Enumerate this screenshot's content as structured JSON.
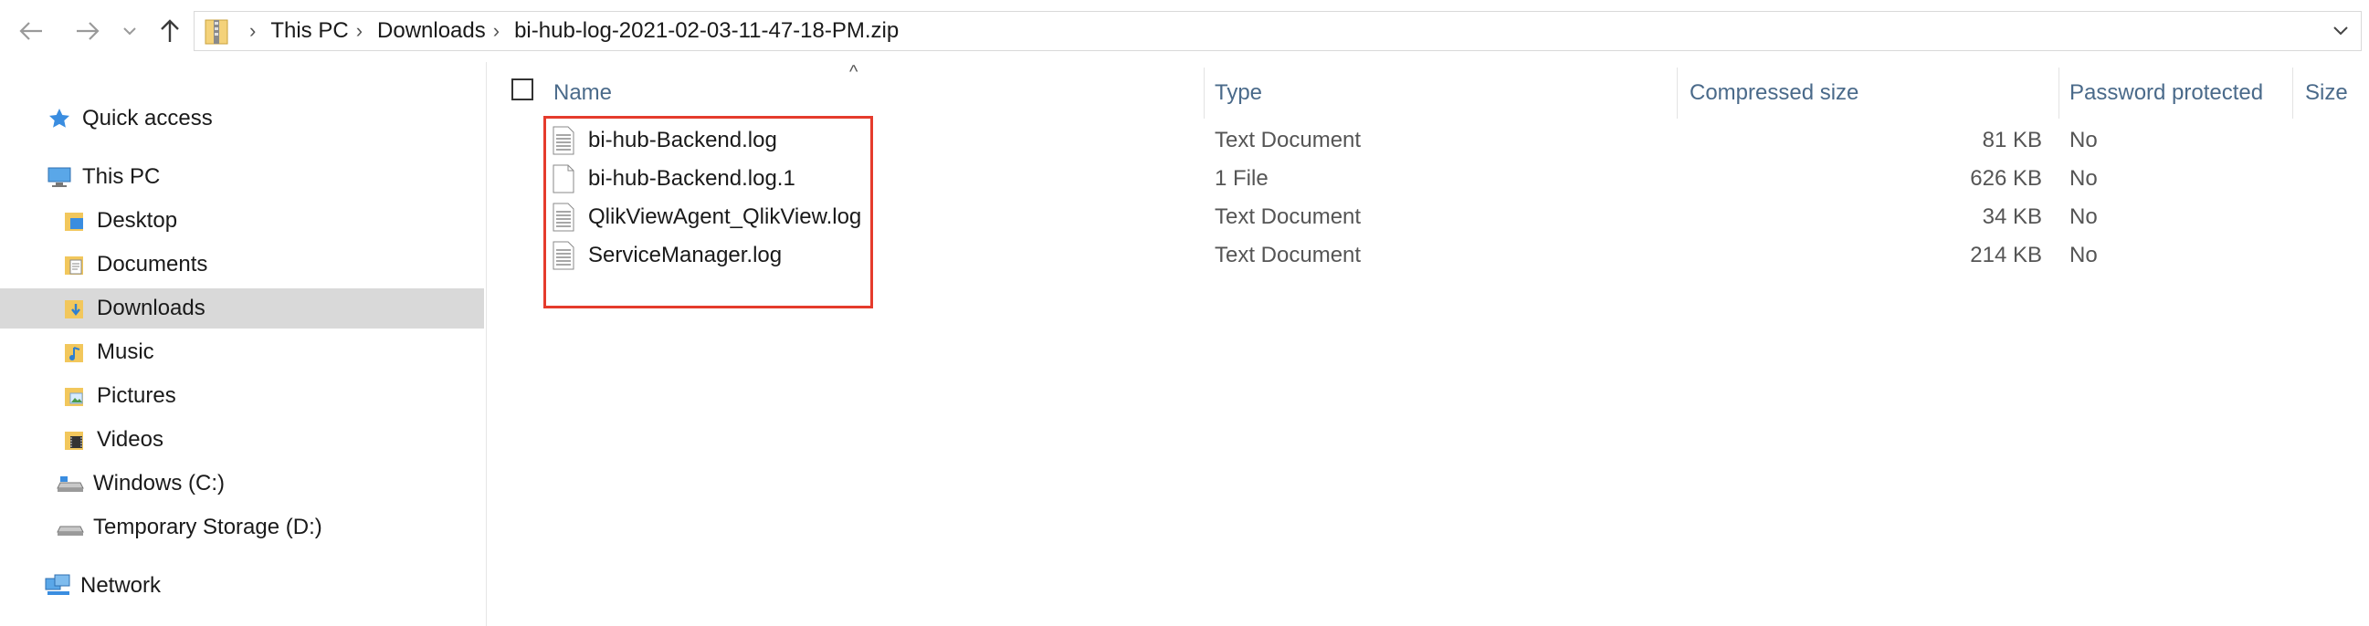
{
  "address": {
    "crumbs": [
      "This PC",
      "Downloads",
      "bi-hub-log-2021-02-03-11-47-18-PM.zip"
    ]
  },
  "sidebar": {
    "items": [
      {
        "label": "Quick access",
        "icon": "star-icon"
      },
      {
        "label": "This PC",
        "icon": "computer-icon"
      },
      {
        "label": "Desktop",
        "icon": "desktop-folder-icon"
      },
      {
        "label": "Documents",
        "icon": "documents-folder-icon"
      },
      {
        "label": "Downloads",
        "icon": "downloads-folder-icon",
        "selected": true
      },
      {
        "label": "Music",
        "icon": "music-folder-icon"
      },
      {
        "label": "Pictures",
        "icon": "pictures-folder-icon"
      },
      {
        "label": "Videos",
        "icon": "videos-folder-icon"
      },
      {
        "label": "Windows (C:)",
        "icon": "drive-icon"
      },
      {
        "label": "Temporary Storage (D:)",
        "icon": "drive-icon"
      },
      {
        "label": "Network",
        "icon": "network-icon"
      }
    ]
  },
  "columns": {
    "name": "Name",
    "type": "Type",
    "compressed_size": "Compressed size",
    "password_protected": "Password protected",
    "size": "Size"
  },
  "files": [
    {
      "name": "bi-hub-Backend.log",
      "type": "Text Document",
      "compressed_size": "81 KB",
      "password_protected": "No",
      "icon": "text-document-icon"
    },
    {
      "name": "bi-hub-Backend.log.1",
      "type": "1 File",
      "compressed_size": "626 KB",
      "password_protected": "No",
      "icon": "blank-file-icon"
    },
    {
      "name": "QlikViewAgent_QlikView.log",
      "type": "Text Document",
      "compressed_size": "34 KB",
      "password_protected": "No",
      "icon": "text-document-icon"
    },
    {
      "name": "ServiceManager.log",
      "type": "Text Document",
      "compressed_size": "214 KB",
      "password_protected": "No",
      "icon": "text-document-icon"
    }
  ],
  "colors": {
    "selected_bg": "#d9d9d9",
    "highlight_border": "#e53b2c",
    "header_text": "#4a6a8a"
  }
}
